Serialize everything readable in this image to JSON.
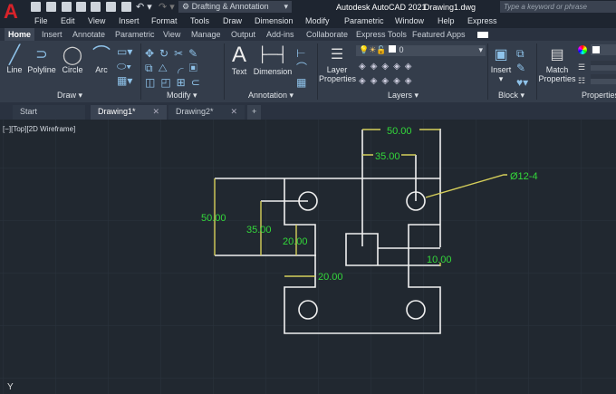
{
  "app": {
    "title": "Autodesk AutoCAD 2021",
    "file": "Drawing1.dwg",
    "workspace": "Drafting & Annotation",
    "search_placeholder": "Type a keyword or phrase",
    "logo": "A"
  },
  "menu": [
    "File",
    "Edit",
    "View",
    "Insert",
    "Format",
    "Tools",
    "Draw",
    "Dimension",
    "Modify",
    "Parametric",
    "Window",
    "Help",
    "Express"
  ],
  "ribbon_tabs": [
    "Home",
    "Insert",
    "Annotate",
    "Parametric",
    "View",
    "Manage",
    "Output",
    "Add-ins",
    "Collaborate",
    "Express Tools",
    "Featured Apps"
  ],
  "panels": {
    "draw": {
      "title": "Draw",
      "tools": [
        "Line",
        "Polyline",
        "Circle",
        "Arc"
      ]
    },
    "modify": {
      "title": "Modify"
    },
    "annotation": {
      "title": "Annotation",
      "tools": [
        "Text",
        "Dimension"
      ]
    },
    "layers": {
      "title": "Layers",
      "tool": "Layer Properties",
      "current_layer": "0"
    },
    "block": {
      "title": "Block",
      "tool": "Insert"
    },
    "properties": {
      "title": "Properties",
      "tool": "Match Properties"
    }
  },
  "doc_tabs": [
    {
      "label": "Start"
    },
    {
      "label": "Drawing1*"
    },
    {
      "label": "Drawing2*"
    }
  ],
  "viewport_label": "[−][Top][2D Wireframe]",
  "dimensions": {
    "top_50": "50.00",
    "top_35": "35.00",
    "left_50": "50.00",
    "left_35": "35.00",
    "mid_20": "20.00",
    "low_20": "20.00",
    "right_10": "10.00",
    "hole": "Ø12-4"
  },
  "ucs_label": "Y",
  "colors": {
    "accent": "#c8202a",
    "dim": "#33d83a",
    "dimline": "#d6cf5a",
    "geometry": "#f0f0f0"
  }
}
